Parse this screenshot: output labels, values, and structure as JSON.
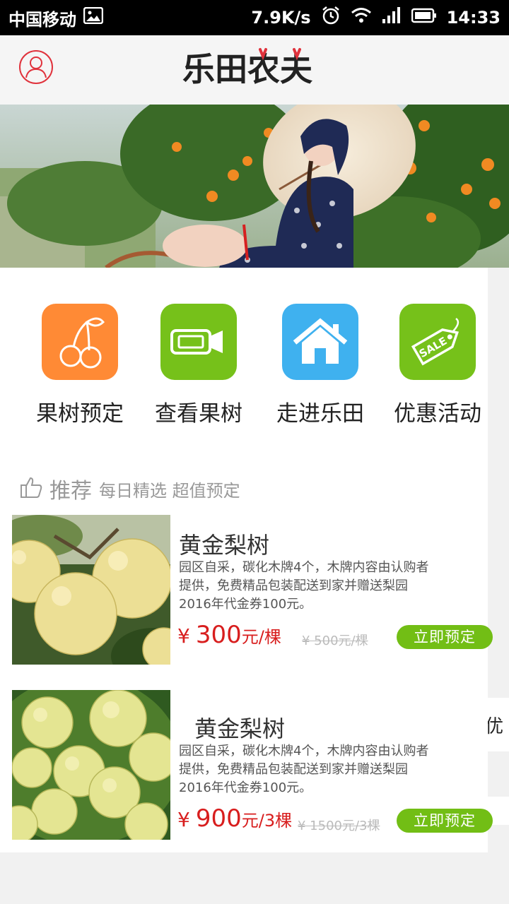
{
  "status_bar": {
    "carrier": "中国移动",
    "speed": "7.9K/s",
    "time": "14:33"
  },
  "header": {
    "logo_text": "乐田农夫"
  },
  "categories": [
    {
      "label": "果树预定",
      "icon": "cherry-icon",
      "color": "#ff8a35"
    },
    {
      "label": "查看果树",
      "icon": "camera-icon",
      "color": "#76c11a"
    },
    {
      "label": "走进乐田",
      "icon": "home-icon",
      "color": "#3fb1ef"
    },
    {
      "label": "优惠活动",
      "icon": "sale-tag-icon",
      "color": "#76c11a"
    }
  ],
  "recommend": {
    "title": "推荐",
    "subtitle": "每日精选 超值预定"
  },
  "products": [
    {
      "name": "黄金梨树",
      "desc_lines": [
        "园区自采，碳化木牌4个，木牌内容由认购者",
        "提供，免费精品包装配送到家并赠送梨园",
        "2016年代金券100元。"
      ],
      "price_symbol": "¥",
      "price": "300",
      "price_unit": "元/棵",
      "old_price": "¥ 500元/棵",
      "button": "立即预定"
    },
    {
      "name": "黄金梨树",
      "desc_lines": [
        "园区自采，碳化木牌4个，木牌内容由认购者",
        "提供，免费精品包装配送到家并赠送梨园",
        "2016年代金券100元。"
      ],
      "price_symbol": "¥",
      "price": "900",
      "price_unit": "元/3棵",
      "old_price": "¥ 1500元/3棵",
      "button": "立即预定"
    }
  ],
  "side_tab": "优",
  "colors": {
    "brand_red": "#d81e1e",
    "button_green": "#72be15"
  }
}
